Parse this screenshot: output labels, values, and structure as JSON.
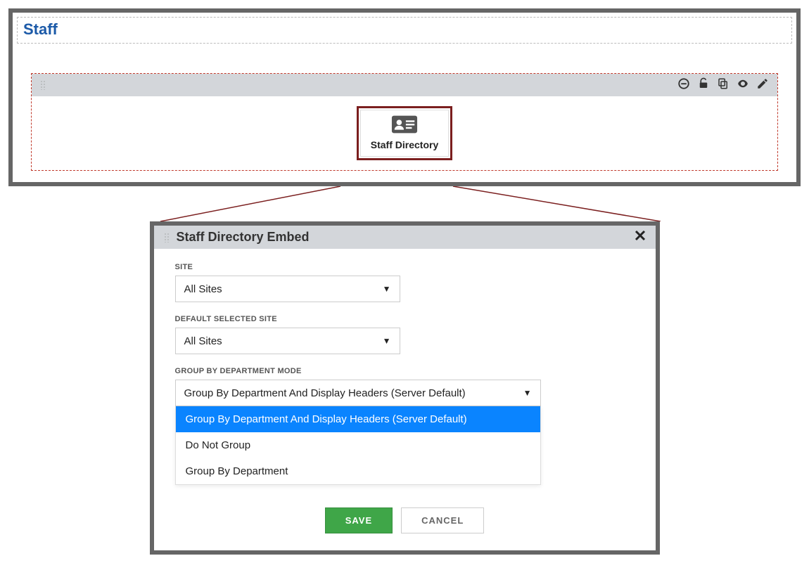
{
  "title": "Staff",
  "widget": {
    "label": "Staff Directory"
  },
  "modal": {
    "title": "Staff Directory Embed",
    "fields": {
      "site": {
        "label": "SITE",
        "value": "All Sites"
      },
      "default_site": {
        "label": "DEFAULT SELECTED SITE",
        "value": "All Sites"
      },
      "group_mode": {
        "label": "GROUP BY DEPARTMENT MODE",
        "value": "Group By Department And Display Headers (Server Default)",
        "options": [
          "Group By Department And Display Headers (Server Default)",
          "Do Not Group",
          "Group By Department"
        ]
      }
    },
    "buttons": {
      "save": "SAVE",
      "cancel": "CANCEL"
    }
  }
}
